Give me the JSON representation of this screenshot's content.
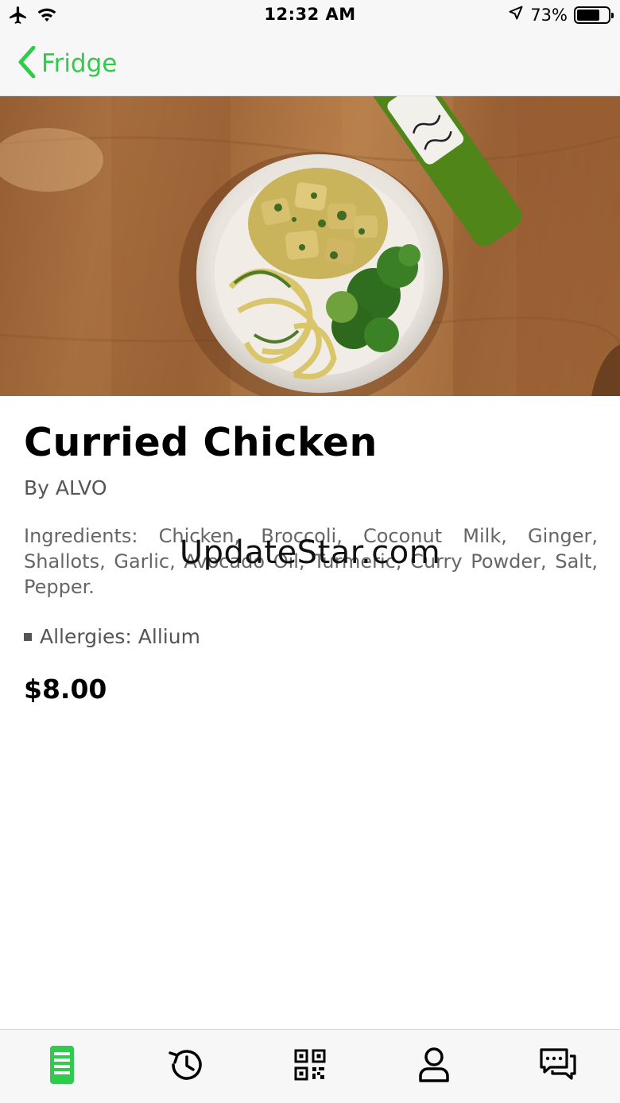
{
  "status_bar": {
    "time": "12:32 AM",
    "battery": "73%",
    "battery_level": 0.73,
    "icons": [
      "airplane-mode-icon",
      "wifi-icon",
      "location-arrow-icon",
      "battery-icon"
    ]
  },
  "nav": {
    "back_label": "Fridge"
  },
  "product": {
    "title": "Curried Chicken",
    "byline": "By ALVO",
    "ingredients": "Ingredients: Chicken, Broccoli, Coconut Milk, Ginger, Shallots, Garlic, Avocado Oil, Turmeric, Curry Powder, Salt, Pepper.",
    "allergies": "Allergies: Allium",
    "price": "$8.00"
  },
  "watermark": "UpdateStar.com",
  "colors": {
    "accent": "#2ecc4a",
    "text": "#000000",
    "secondary_text": "#555555"
  },
  "tabs": [
    {
      "icon": "menu-list-icon",
      "active": true
    },
    {
      "icon": "history-icon",
      "active": false
    },
    {
      "icon": "qr-code-icon",
      "active": false
    },
    {
      "icon": "profile-icon",
      "active": false
    },
    {
      "icon": "chat-icon",
      "active": false
    }
  ]
}
